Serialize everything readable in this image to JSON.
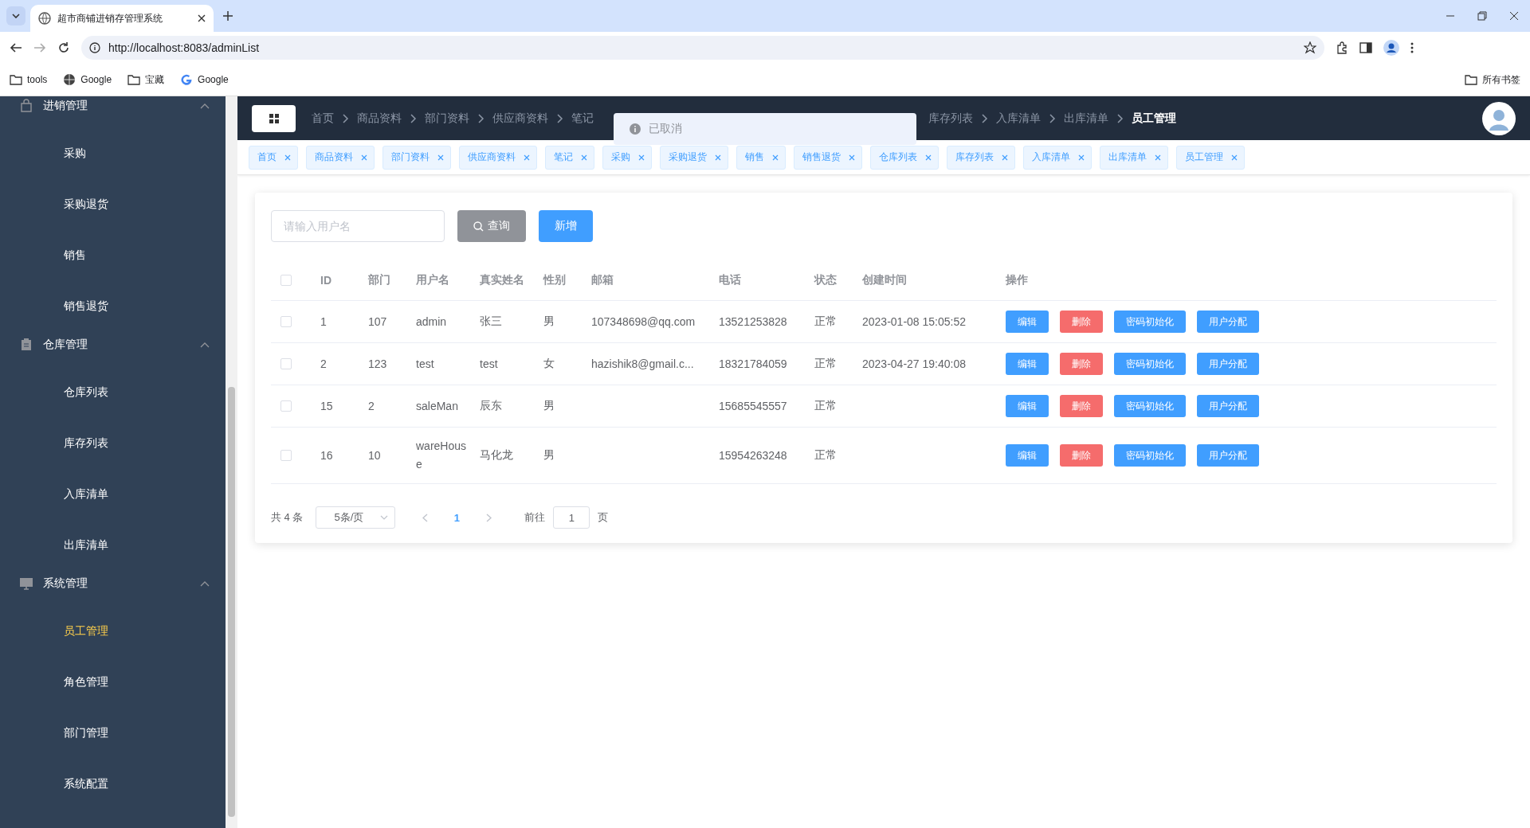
{
  "browser": {
    "tab_title": "超市商铺进销存管理系统",
    "url": "http://localhost:8083/adminList",
    "bookmarks": [
      {
        "label": "tools",
        "kind": "folder"
      },
      {
        "label": "Google",
        "kind": "globe"
      },
      {
        "label": "宝藏",
        "kind": "folder"
      },
      {
        "label": "Google",
        "kind": "google"
      }
    ],
    "all_bookmarks": "所有书签"
  },
  "sidebar": {
    "groups": [
      {
        "title": "进销管理",
        "kind": "bag",
        "expanded": true,
        "items": [
          {
            "label": "采购",
            "selected": false
          },
          {
            "label": "采购退货",
            "selected": false
          },
          {
            "label": "销售",
            "selected": false
          },
          {
            "label": "销售退货",
            "selected": false
          }
        ]
      },
      {
        "title": "仓库管理",
        "kind": "clipboard",
        "expanded": true,
        "items": [
          {
            "label": "仓库列表",
            "selected": false
          },
          {
            "label": "库存列表",
            "selected": false
          },
          {
            "label": "入库清单",
            "selected": false
          },
          {
            "label": "出库清单",
            "selected": false
          }
        ]
      },
      {
        "title": "系统管理",
        "kind": "monitor",
        "expanded": true,
        "items": [
          {
            "label": "员工管理",
            "selected": true
          },
          {
            "label": "角色管理",
            "selected": false
          },
          {
            "label": "部门管理",
            "selected": false
          },
          {
            "label": "系统配置",
            "selected": false
          }
        ]
      }
    ]
  },
  "breadcrumb": [
    "首页",
    "商品资料",
    "部门资料",
    "供应商资料",
    "笔记"
  ],
  "breadcrumb_continued": [
    "库存列表",
    "入库清单",
    "出库清单",
    "员工管理"
  ],
  "toast": {
    "text": "已取消"
  },
  "tags": [
    "首页",
    "商品资料",
    "部门资料",
    "供应商资料",
    "笔记",
    "采购",
    "采购退货",
    "销售",
    "销售退货",
    "仓库列表",
    "库存列表",
    "入库清单",
    "出库清单",
    "员工管理"
  ],
  "search": {
    "placeholder": "请输入用户名"
  },
  "buttons": [
    {
      "label": "查询",
      "kind": "search"
    },
    {
      "label": "新增",
      "kind": "primary"
    }
  ],
  "table": {
    "header_checked": false,
    "columns": [
      "ID",
      "部门",
      "用户名",
      "真实姓名",
      "性别",
      "邮箱",
      "电话",
      "状态",
      "创建时间",
      "操作"
    ],
    "rows": [
      {
        "checked": false,
        "cells": [
          "1",
          "107",
          "admin",
          "张三",
          "男",
          "107348698@qq.com",
          "13521253828",
          "正常",
          "2023-01-08 15:05:52"
        ],
        "actions": [
          {
            "label": "编辑",
            "kind": "primary"
          },
          {
            "label": "删除",
            "kind": "danger"
          },
          {
            "label": "密码初始化",
            "kind": "primary"
          },
          {
            "label": "用户分配",
            "kind": "primary"
          }
        ]
      },
      {
        "checked": false,
        "cells": [
          "2",
          "123",
          "test",
          "test",
          "女",
          "hazishik8@gmail.c...",
          "18321784059",
          "正常",
          "2023-04-27 19:40:08"
        ],
        "actions": [
          {
            "label": "编辑",
            "kind": "primary"
          },
          {
            "label": "删除",
            "kind": "danger"
          },
          {
            "label": "密码初始化",
            "kind": "primary"
          },
          {
            "label": "用户分配",
            "kind": "primary"
          }
        ]
      },
      {
        "checked": false,
        "cells": [
          "15",
          "2",
          "saleMan",
          "辰东",
          "男",
          "",
          "15685545557",
          "正常",
          ""
        ],
        "actions": [
          {
            "label": "编辑",
            "kind": "primary"
          },
          {
            "label": "删除",
            "kind": "danger"
          },
          {
            "label": "密码初始化",
            "kind": "primary"
          },
          {
            "label": "用户分配",
            "kind": "primary"
          }
        ]
      },
      {
        "checked": false,
        "cells": [
          "16",
          "10",
          "wareHouse",
          "马化龙",
          "男",
          "",
          "15954263248",
          "正常",
          ""
        ],
        "actions": [
          {
            "label": "编辑",
            "kind": "primary"
          },
          {
            "label": "删除",
            "kind": "danger"
          },
          {
            "label": "密码初始化",
            "kind": "primary"
          },
          {
            "label": "用户分配",
            "kind": "primary"
          }
        ]
      }
    ]
  },
  "pagination": {
    "total": "共 4 条",
    "page_size": "5条/页",
    "pages": [
      {
        "label": "1",
        "selected": true
      }
    ],
    "goto_label": "前往",
    "goto_value": "1",
    "page_suffix": "页"
  }
}
